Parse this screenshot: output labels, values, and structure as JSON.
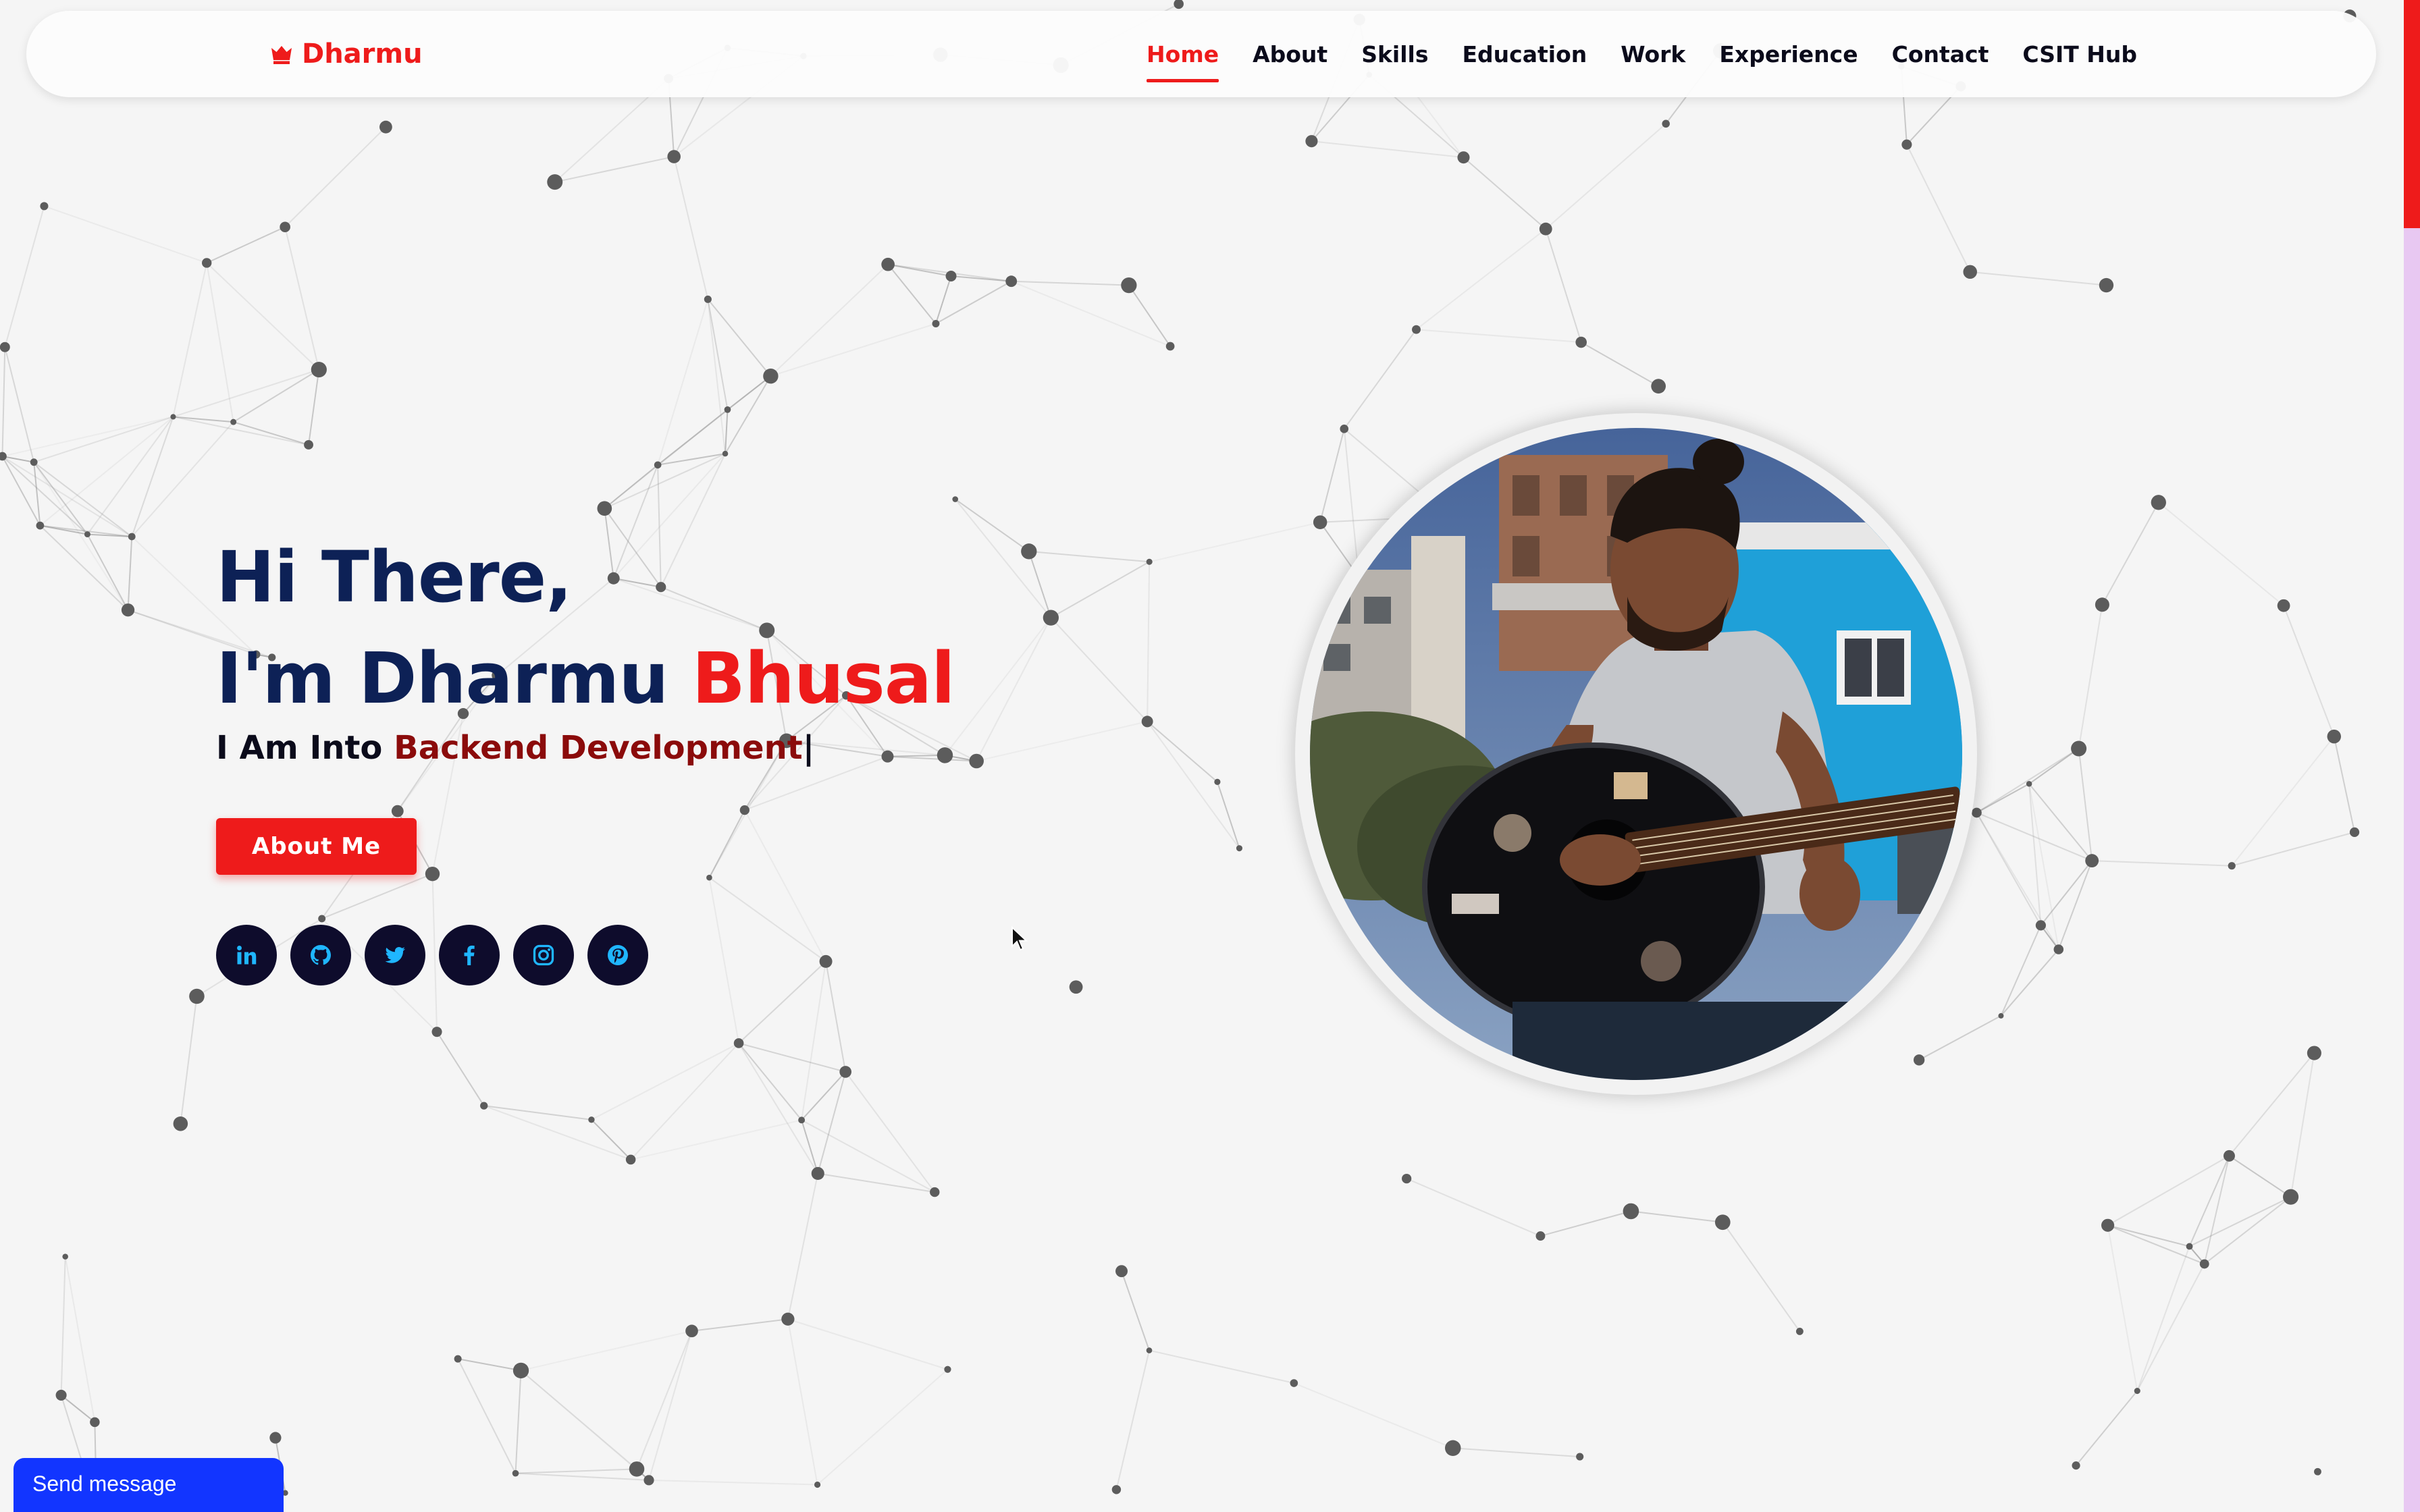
{
  "navbar": {
    "brand": "Dharmu",
    "links": [
      {
        "label": "Home",
        "active": true
      },
      {
        "label": "About"
      },
      {
        "label": "Skills"
      },
      {
        "label": "Education"
      },
      {
        "label": "Work"
      },
      {
        "label": "Experience"
      },
      {
        "label": "Contact"
      },
      {
        "label": "CSIT Hub"
      }
    ]
  },
  "hero": {
    "greeting": "Hi There,",
    "name_prefix": "I'm Dharmu ",
    "name_highlight": "Bhusal",
    "intro_prefix": "I Am Into ",
    "intro_role": "Backend Development",
    "intro_cursor": "|",
    "about_button": "About Me"
  },
  "socials": [
    {
      "name": "linkedin-icon"
    },
    {
      "name": "github-icon"
    },
    {
      "name": "twitter-icon"
    },
    {
      "name": "facebook-icon"
    },
    {
      "name": "instagram-icon"
    },
    {
      "name": "pinterest-icon"
    }
  ],
  "chat": {
    "send_message": "Send message"
  },
  "colors": {
    "accent": "#ee1b1b",
    "navy": "#0d2156",
    "role": "#8b0b0b",
    "social_bg": "#0e0c2c",
    "social_icon": "#1fb6ff",
    "chat_blue": "#1235ff"
  }
}
